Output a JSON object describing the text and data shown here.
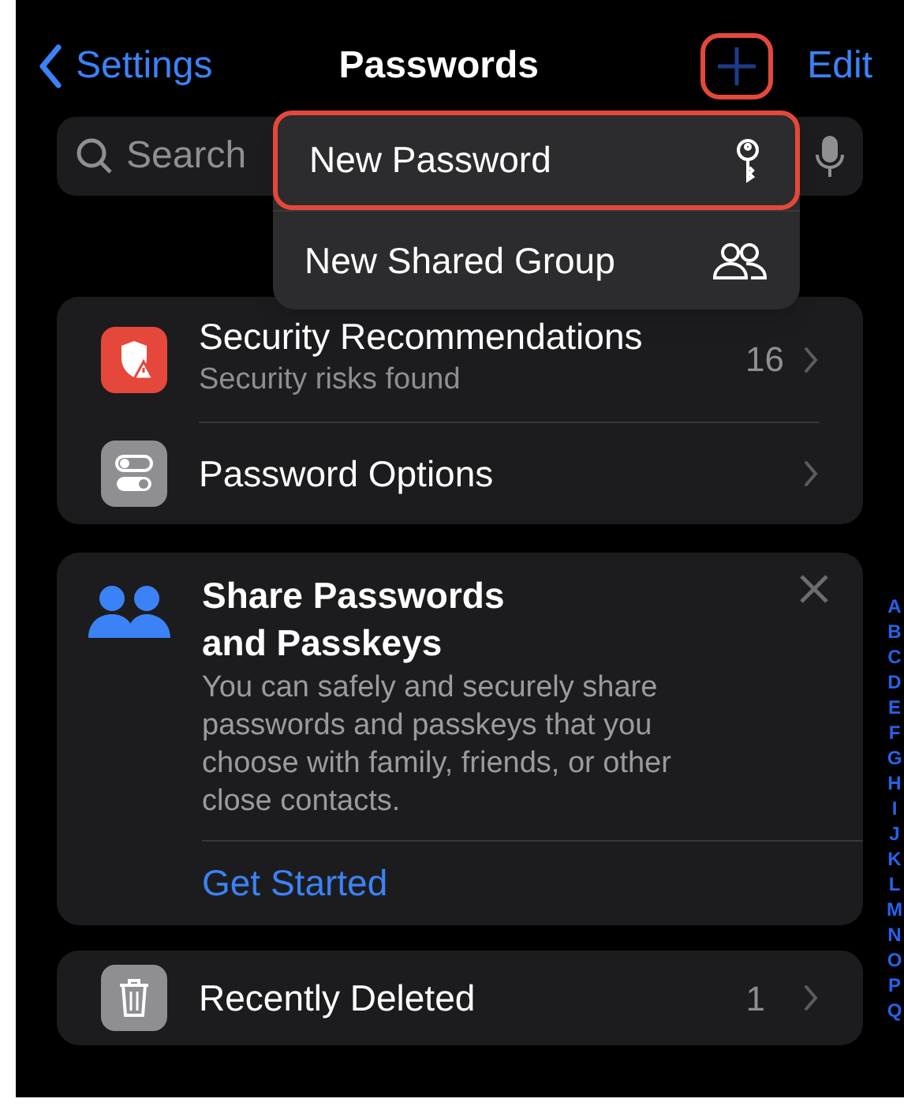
{
  "nav": {
    "back": "Settings",
    "title": "Passwords",
    "add_highlighted": true,
    "edit": "Edit"
  },
  "search": {
    "placeholder": "Search"
  },
  "menu": [
    {
      "label": "New Password",
      "kind": "key",
      "highlighted": true
    },
    {
      "label": "New Shared Group",
      "kind": "people",
      "highlighted": false
    }
  ],
  "settings": [
    {
      "title": "Security Recommendations",
      "subtitle": "Security risks found",
      "count": "16",
      "kind": "shield"
    },
    {
      "title": "Password Options",
      "kind": "toggles"
    }
  ],
  "share_card": {
    "title": "Share Passwords and Passkeys",
    "body": "You can safely and securely share passwords and passkeys that you choose with family, friends, or other close contacts.",
    "action": "Get Started"
  },
  "deleted": {
    "title": "Recently Deleted",
    "count": "1"
  },
  "index": [
    "A",
    "B",
    "C",
    "D",
    "E",
    "F",
    "G",
    "H",
    "I",
    "J",
    "K",
    "L",
    "M",
    "N",
    "O",
    "P",
    "Q"
  ]
}
